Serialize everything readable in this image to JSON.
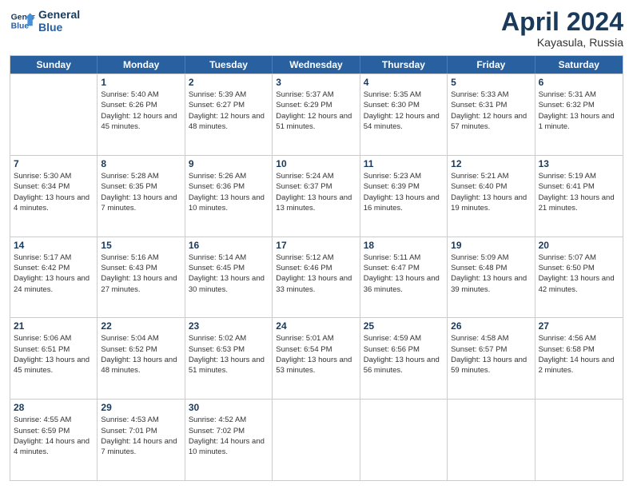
{
  "header": {
    "logo_line1": "General",
    "logo_line2": "Blue",
    "month": "April 2024",
    "location": "Kayasula, Russia"
  },
  "weekdays": [
    "Sunday",
    "Monday",
    "Tuesday",
    "Wednesday",
    "Thursday",
    "Friday",
    "Saturday"
  ],
  "weeks": [
    [
      {
        "day": null
      },
      {
        "day": "1",
        "sunrise": "5:40 AM",
        "sunset": "6:26 PM",
        "daylight": "12 hours and 45 minutes."
      },
      {
        "day": "2",
        "sunrise": "5:39 AM",
        "sunset": "6:27 PM",
        "daylight": "12 hours and 48 minutes."
      },
      {
        "day": "3",
        "sunrise": "5:37 AM",
        "sunset": "6:29 PM",
        "daylight": "12 hours and 51 minutes."
      },
      {
        "day": "4",
        "sunrise": "5:35 AM",
        "sunset": "6:30 PM",
        "daylight": "12 hours and 54 minutes."
      },
      {
        "day": "5",
        "sunrise": "5:33 AM",
        "sunset": "6:31 PM",
        "daylight": "12 hours and 57 minutes."
      },
      {
        "day": "6",
        "sunrise": "5:31 AM",
        "sunset": "6:32 PM",
        "daylight": "13 hours and 1 minute."
      }
    ],
    [
      {
        "day": "7",
        "sunrise": "5:30 AM",
        "sunset": "6:34 PM",
        "daylight": "13 hours and 4 minutes."
      },
      {
        "day": "8",
        "sunrise": "5:28 AM",
        "sunset": "6:35 PM",
        "daylight": "13 hours and 7 minutes."
      },
      {
        "day": "9",
        "sunrise": "5:26 AM",
        "sunset": "6:36 PM",
        "daylight": "13 hours and 10 minutes."
      },
      {
        "day": "10",
        "sunrise": "5:24 AM",
        "sunset": "6:37 PM",
        "daylight": "13 hours and 13 minutes."
      },
      {
        "day": "11",
        "sunrise": "5:23 AM",
        "sunset": "6:39 PM",
        "daylight": "13 hours and 16 minutes."
      },
      {
        "day": "12",
        "sunrise": "5:21 AM",
        "sunset": "6:40 PM",
        "daylight": "13 hours and 19 minutes."
      },
      {
        "day": "13",
        "sunrise": "5:19 AM",
        "sunset": "6:41 PM",
        "daylight": "13 hours and 21 minutes."
      }
    ],
    [
      {
        "day": "14",
        "sunrise": "5:17 AM",
        "sunset": "6:42 PM",
        "daylight": "13 hours and 24 minutes."
      },
      {
        "day": "15",
        "sunrise": "5:16 AM",
        "sunset": "6:43 PM",
        "daylight": "13 hours and 27 minutes."
      },
      {
        "day": "16",
        "sunrise": "5:14 AM",
        "sunset": "6:45 PM",
        "daylight": "13 hours and 30 minutes."
      },
      {
        "day": "17",
        "sunrise": "5:12 AM",
        "sunset": "6:46 PM",
        "daylight": "13 hours and 33 minutes."
      },
      {
        "day": "18",
        "sunrise": "5:11 AM",
        "sunset": "6:47 PM",
        "daylight": "13 hours and 36 minutes."
      },
      {
        "day": "19",
        "sunrise": "5:09 AM",
        "sunset": "6:48 PM",
        "daylight": "13 hours and 39 minutes."
      },
      {
        "day": "20",
        "sunrise": "5:07 AM",
        "sunset": "6:50 PM",
        "daylight": "13 hours and 42 minutes."
      }
    ],
    [
      {
        "day": "21",
        "sunrise": "5:06 AM",
        "sunset": "6:51 PM",
        "daylight": "13 hours and 45 minutes."
      },
      {
        "day": "22",
        "sunrise": "5:04 AM",
        "sunset": "6:52 PM",
        "daylight": "13 hours and 48 minutes."
      },
      {
        "day": "23",
        "sunrise": "5:02 AM",
        "sunset": "6:53 PM",
        "daylight": "13 hours and 51 minutes."
      },
      {
        "day": "24",
        "sunrise": "5:01 AM",
        "sunset": "6:54 PM",
        "daylight": "13 hours and 53 minutes."
      },
      {
        "day": "25",
        "sunrise": "4:59 AM",
        "sunset": "6:56 PM",
        "daylight": "13 hours and 56 minutes."
      },
      {
        "day": "26",
        "sunrise": "4:58 AM",
        "sunset": "6:57 PM",
        "daylight": "13 hours and 59 minutes."
      },
      {
        "day": "27",
        "sunrise": "4:56 AM",
        "sunset": "6:58 PM",
        "daylight": "14 hours and 2 minutes."
      }
    ],
    [
      {
        "day": "28",
        "sunrise": "4:55 AM",
        "sunset": "6:59 PM",
        "daylight": "14 hours and 4 minutes."
      },
      {
        "day": "29",
        "sunrise": "4:53 AM",
        "sunset": "7:01 PM",
        "daylight": "14 hours and 7 minutes."
      },
      {
        "day": "30",
        "sunrise": "4:52 AM",
        "sunset": "7:02 PM",
        "daylight": "14 hours and 10 minutes."
      },
      {
        "day": null
      },
      {
        "day": null
      },
      {
        "day": null
      },
      {
        "day": null
      }
    ]
  ]
}
